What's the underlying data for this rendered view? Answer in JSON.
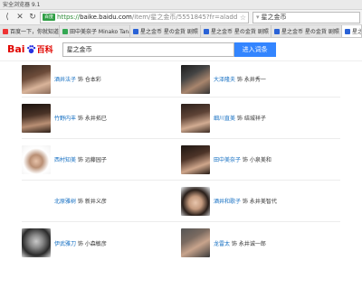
{
  "window": {
    "title": "安全浏览器 9.1"
  },
  "address_bar": {
    "secure_label": "百度",
    "url_scheme": "https://",
    "url_host": "baike.baidu.com",
    "url_path": "/item/星之金币/5551845?fr=aladd",
    "search_value": "星之金币"
  },
  "tabs": [
    {
      "label": "百度一下，你就知道",
      "favicon": "paw",
      "active": false
    },
    {
      "label": "田中美奈子 Minako Tana",
      "favicon": "green",
      "active": false
    },
    {
      "label": "星之金币 星の金貨 剧照",
      "favicon": "blue",
      "active": false
    },
    {
      "label": "星之金币 星の金貨 剧照",
      "favicon": "blue",
      "active": false
    },
    {
      "label": "星之金币 星の金貨 剧照",
      "favicon": "blue",
      "active": false
    },
    {
      "label": "星之金币",
      "favicon": "blue",
      "active": true
    }
  ],
  "baike": {
    "logo_left": "Bai",
    "logo_right": "百科",
    "search_value": "星之金币",
    "search_button": "进入词条"
  },
  "cast": [
    [
      {
        "actor": "酒井法子",
        "role": " 饰 仓本彩",
        "photo": true
      },
      {
        "actor": "大泽隆夫",
        "role": " 饰 永井秀一",
        "photo": true
      }
    ],
    [
      {
        "actor": "竹野内丰",
        "role": " 饰 永井拓巳",
        "photo": true
      },
      {
        "actor": "细川直美",
        "role": " 饰 结城祥子",
        "photo": true
      }
    ],
    [
      {
        "actor": "西村知美",
        "role": " 饰 远藤园子",
        "photo": true
      },
      {
        "actor": "田中美奈子",
        "role": " 饰 小泉美和",
        "photo": true
      }
    ],
    [
      {
        "actor": "北原雅树",
        "role": " 饰 新井义彦",
        "photo": false
      },
      {
        "actor": "酒井和歌子",
        "role": " 饰 永井美智代",
        "photo": true
      }
    ],
    [
      {
        "actor": "伊武雅刀",
        "role": " 饰 小森敏彦",
        "photo": true
      },
      {
        "actor": "龙雷太",
        "role": " 饰 永井诚一郎",
        "photo": true
      }
    ]
  ]
}
